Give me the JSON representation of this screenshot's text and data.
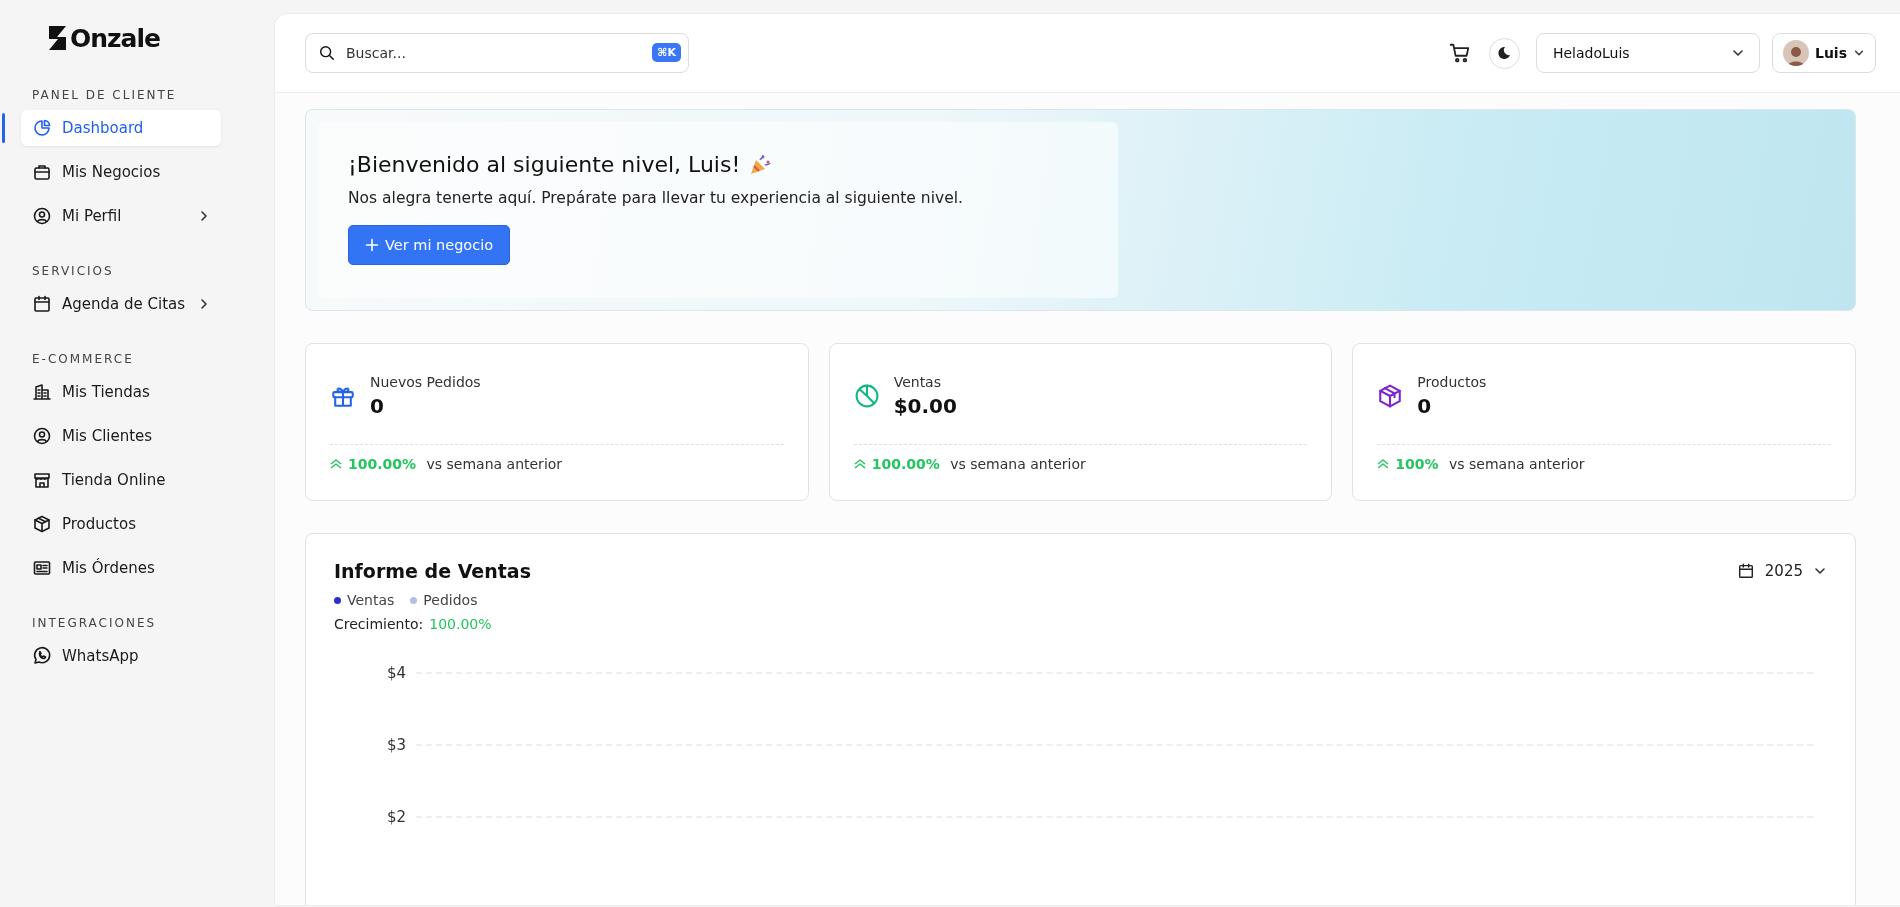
{
  "sidebar": {
    "logo": "Onzale",
    "sections": [
      {
        "heading": "PANEL DE CLIENTE",
        "items": [
          {
            "label": "Dashboard",
            "selected": true,
            "submenu": false
          },
          {
            "label": "Mis Negocios",
            "selected": false,
            "submenu": false
          },
          {
            "label": "Mi Perfil",
            "selected": false,
            "submenu": true
          }
        ]
      },
      {
        "heading": "SERVICIOS",
        "items": [
          {
            "label": "Agenda de Citas",
            "selected": false,
            "submenu": true
          }
        ]
      },
      {
        "heading": "E-COMMERCE",
        "items": [
          {
            "label": "Mis Tiendas",
            "selected": false,
            "submenu": false
          },
          {
            "label": "Mis Clientes",
            "selected": false,
            "submenu": false
          },
          {
            "label": "Tienda Online",
            "selected": false,
            "submenu": false
          },
          {
            "label": "Productos",
            "selected": false,
            "submenu": false
          },
          {
            "label": "Mis Órdenes",
            "selected": false,
            "submenu": false
          }
        ]
      },
      {
        "heading": "INTEGRACIONES",
        "items": [
          {
            "label": "WhatsApp",
            "selected": false,
            "submenu": false
          }
        ]
      }
    ]
  },
  "header": {
    "search": {
      "placeholder": "Buscar...",
      "shortcut": "⌘K"
    },
    "business_select": {
      "value": "HeladoLuis"
    },
    "user_menu": {
      "name": "Luis"
    }
  },
  "banner": {
    "title": "¡Bienvenido al siguiente nivel, Luis!",
    "subtitle": "Nos alegra tenerte aquí. Prepárate para llevar tu experiencia al siguiente nivel.",
    "button": "Ver mi negocio"
  },
  "stats": [
    {
      "label": "Nuevos Pedidos",
      "value": "0",
      "change": "100.00%",
      "comparison": "vs semana anterior",
      "color": "#2563eb"
    },
    {
      "label": "Ventas",
      "value": "$0.00",
      "change": "100.00%",
      "comparison": "vs semana anterior",
      "color": "#10b981"
    },
    {
      "label": "Productos",
      "value": "0",
      "change": "100%",
      "comparison": "vs semana anterior",
      "color": "#7e22ce"
    }
  ],
  "sales_report": {
    "title": "Informe de Ventas",
    "year_select": "2025",
    "legend": [
      {
        "label": "Ventas",
        "color": "#2b2fd1"
      },
      {
        "label": "Pedidos",
        "color": "#b4bde8"
      }
    ],
    "growth_label": "Crecimiento:",
    "growth_value": "100.00%",
    "y_axis_labels": [
      "$4",
      "$3",
      "$2"
    ]
  }
}
